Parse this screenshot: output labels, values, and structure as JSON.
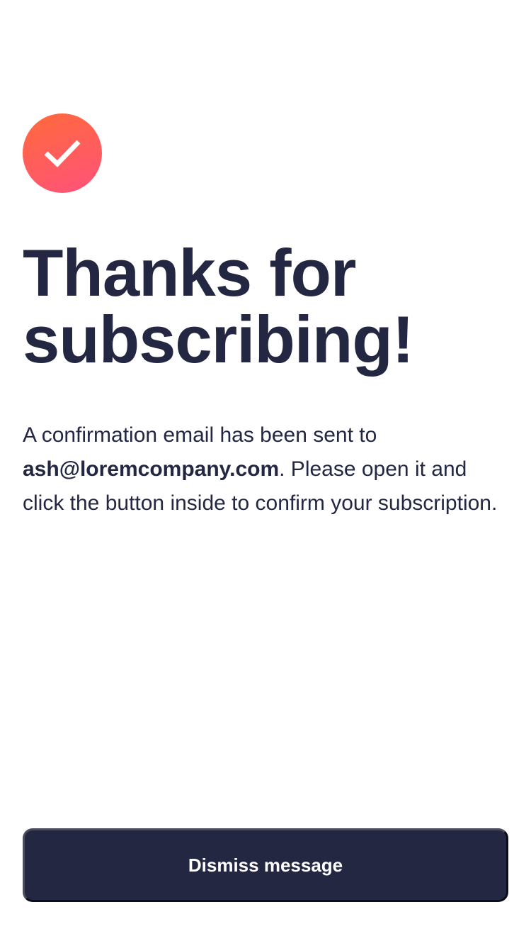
{
  "success": {
    "icon": "checkmark-icon",
    "gradient": [
      "#ff6a3a",
      "#ff527b"
    ]
  },
  "title": "Thanks for subscribing!",
  "message": {
    "prefix": "A confirmation email has been sent to ",
    "email": "ash@loremcompany.com",
    "suffix": ". Please open it and click the button inside to confirm your subscription."
  },
  "dismiss_button": {
    "label": "Dismiss message"
  },
  "colors": {
    "text": "#242742",
    "button_bg": "#242742",
    "button_text": "#ffffff",
    "background": "#ffffff"
  }
}
